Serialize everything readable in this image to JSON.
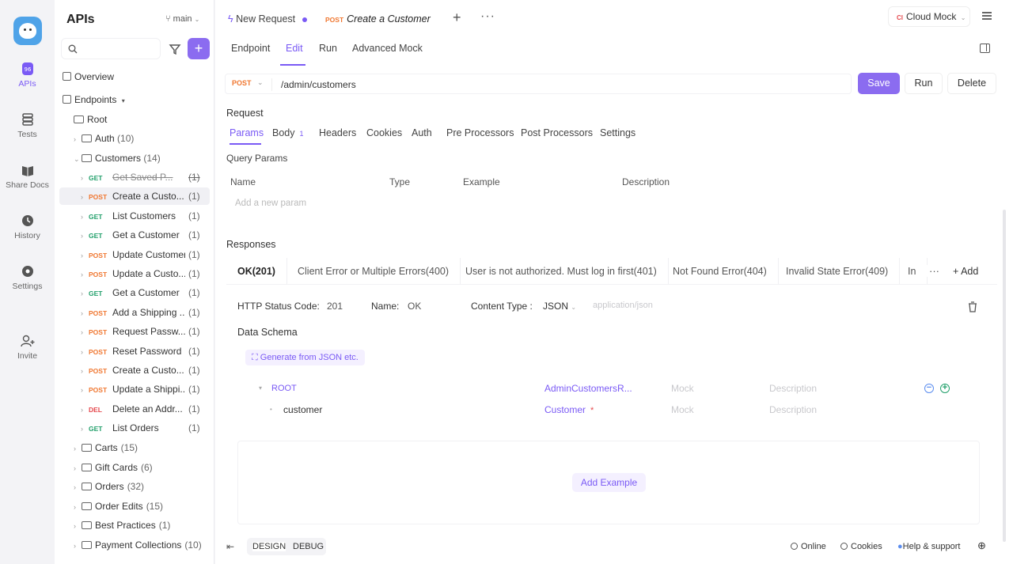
{
  "rail": {
    "items": [
      {
        "label": "APIs",
        "icon": "apis-icon"
      },
      {
        "label": "Tests",
        "icon": "tests-icon"
      },
      {
        "label": "Share Docs",
        "icon": "share-docs-icon"
      },
      {
        "label": "History",
        "icon": "history-icon"
      },
      {
        "label": "Settings",
        "icon": "settings-icon"
      },
      {
        "label": "Invite",
        "icon": "invite-icon"
      }
    ]
  },
  "sidebar": {
    "title": "APIs",
    "branch": "main",
    "overview": "Overview",
    "endpoints": "Endpoints",
    "root": "Root",
    "auth": {
      "label": "Auth",
      "count": "(10)"
    },
    "customers": {
      "label": "Customers",
      "count": "(14)"
    },
    "endpoints_list": [
      {
        "method": "GET",
        "label": "Get Saved P...",
        "count": "(1)"
      },
      {
        "method": "POST",
        "label": "Create a Custo...",
        "count": "(1)"
      },
      {
        "method": "GET",
        "label": "List Customers",
        "count": "(1)"
      },
      {
        "method": "GET",
        "label": "Get a Customer",
        "count": "(1)"
      },
      {
        "method": "POST",
        "label": "Update Customer",
        "count": "(1)"
      },
      {
        "method": "POST",
        "label": "Update a Custo...",
        "count": "(1)"
      },
      {
        "method": "GET",
        "label": "Get a Customer",
        "count": "(1)"
      },
      {
        "method": "POST",
        "label": "Add a Shipping ...",
        "count": "(1)"
      },
      {
        "method": "POST",
        "label": "Request Passw...",
        "count": "(1)"
      },
      {
        "method": "POST",
        "label": "Reset Password",
        "count": "(1)"
      },
      {
        "method": "POST",
        "label": "Create a Custo...",
        "count": "(1)"
      },
      {
        "method": "POST",
        "label": "Update a Shippi...",
        "count": "(1)"
      },
      {
        "method": "DEL",
        "label": "Delete an Addr...",
        "count": "(1)"
      },
      {
        "method": "GET",
        "label": "List Orders",
        "count": "(1)"
      }
    ],
    "folders": [
      {
        "label": "Carts",
        "count": "(15)"
      },
      {
        "label": "Gift Cards",
        "count": "(6)"
      },
      {
        "label": "Orders",
        "count": "(32)"
      },
      {
        "label": "Order Edits",
        "count": "(15)"
      },
      {
        "label": "Best Practices",
        "count": "(1)"
      },
      {
        "label": "Payment Collections",
        "count": "(10)"
      }
    ]
  },
  "tabs": {
    "new_request": "New Request",
    "current_method": "POST",
    "current": "Create a Customer",
    "env": "Cloud Mock",
    "env_prefix": "Cl"
  },
  "subtabs": [
    "Endpoint",
    "Edit",
    "Run",
    "Advanced Mock"
  ],
  "request": {
    "method": "POST",
    "path": "/admin/customers",
    "save": "Save",
    "run": "Run",
    "delete": "Delete",
    "section": "Request",
    "param_tabs": [
      "Params",
      "Body",
      "Headers",
      "Cookies",
      "Auth",
      "Pre Processors",
      "Post Processors",
      "Settings"
    ],
    "body_badge": "1",
    "query_params": "Query Params",
    "columns": [
      "Name",
      "Type",
      "Example",
      "Description"
    ],
    "add_param": "Add a new param"
  },
  "responses": {
    "section": "Responses",
    "tabs": [
      "OK(201)",
      "Client Error or Multiple Errors(400)",
      "User is not authorized. Must log in first(401)",
      "Not Found Error(404)",
      "Invalid State Error(409)",
      "In"
    ],
    "add": "Add",
    "status_label": "HTTP Status Code:",
    "status_value": "201",
    "name_label": "Name:",
    "name_value": "OK",
    "ctype_label": "Content Type :",
    "ctype_value": "JSON",
    "ctype_mime": "application/json",
    "schema_title": "Data Schema",
    "generate": "Generate from JSON etc.",
    "schema": [
      {
        "name": "ROOT",
        "type": "AdminCustomersR...",
        "mock": "Mock",
        "desc": "Description"
      },
      {
        "name": "customer",
        "type": "Customer",
        "required": "*",
        "mock": "Mock",
        "desc": "Description"
      }
    ],
    "add_example": "Add Example"
  },
  "footer": {
    "design": "DESIGN",
    "debug": "DEBUG",
    "online": "Online",
    "cookies": "Cookies",
    "help": "Help & support"
  },
  "colors": {
    "accent": "#8b6cf0",
    "get": "#22a06b",
    "post": "#f07832",
    "delete": "#e5484d"
  }
}
